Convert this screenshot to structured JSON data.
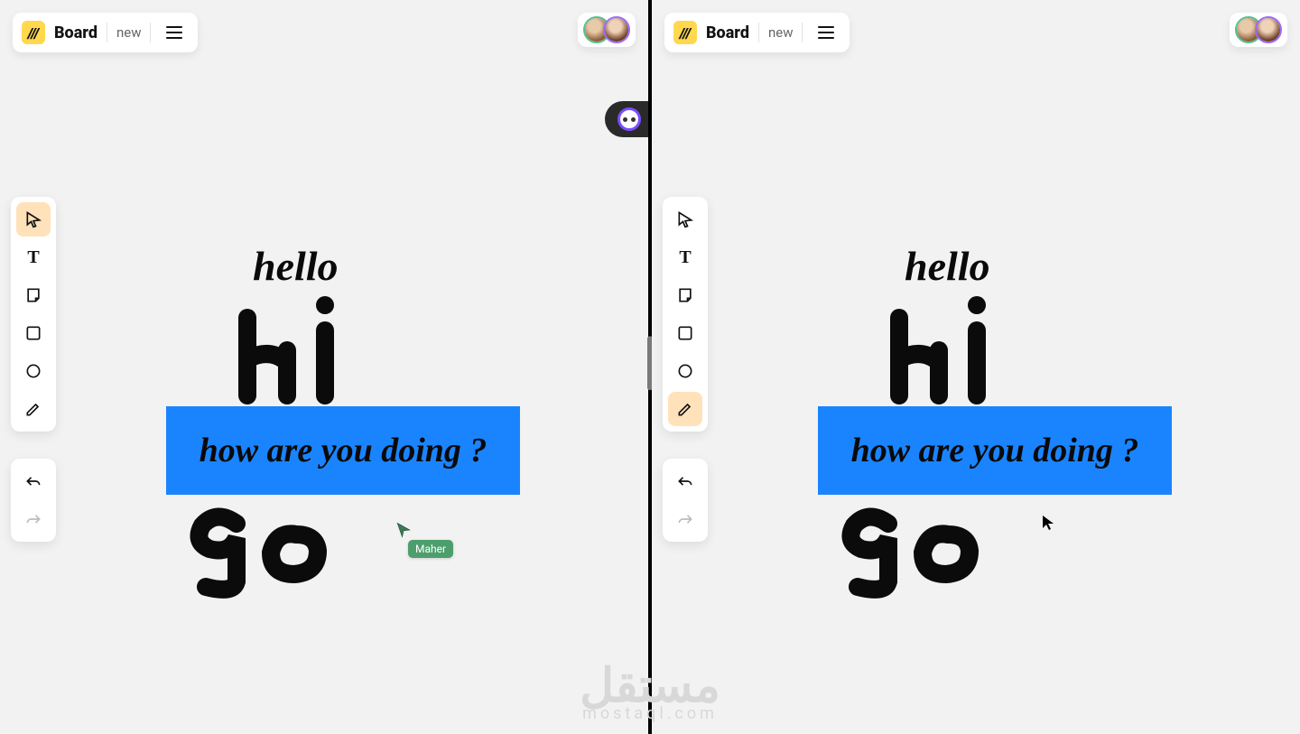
{
  "header": {
    "title": "Board",
    "status": "new",
    "logo_glyph": "///"
  },
  "toolbar": {
    "tools": [
      "pointer",
      "text",
      "note",
      "rectangle",
      "ellipse",
      "pen"
    ],
    "active_left": "pointer",
    "active_right": "pen"
  },
  "canvas": {
    "hello": "hello",
    "hi": "HI",
    "box_text": "how are you doing ?",
    "go": "go",
    "box_color": "#1a84ff"
  },
  "collaborators": {
    "remote_cursor_name": "Maher",
    "remote_cursor_color": "#4d9e6d",
    "avatars": [
      {
        "ring": "#55c08f"
      },
      {
        "ring": "#9c6bff"
      }
    ]
  },
  "watermark": {
    "ar": "مستقل",
    "en": "mostaql.com"
  }
}
